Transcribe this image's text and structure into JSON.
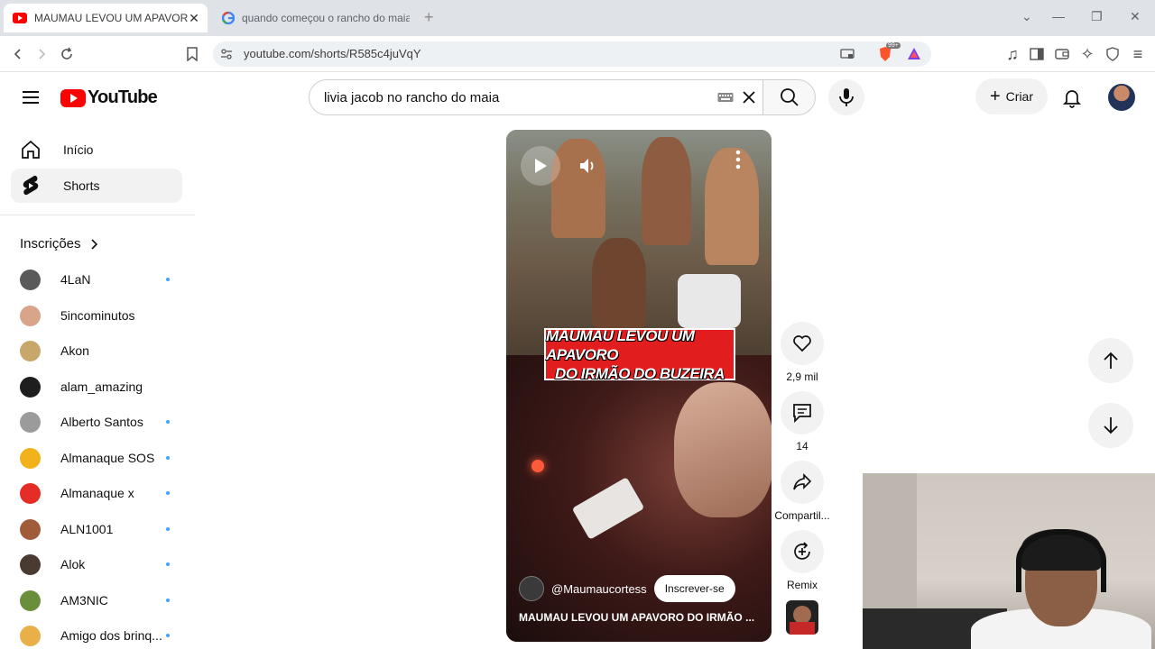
{
  "browser": {
    "tabs": [
      {
        "title": "MAUMAU LEVOU UM APAVORO",
        "active": true
      },
      {
        "title": "quando começou o rancho do maia",
        "active": false
      }
    ],
    "url": "youtube.com/shorts/R585c4juVqY",
    "extension_badge": "99+"
  },
  "header": {
    "logo_text": "YouTube",
    "search_query": "livia jacob no rancho do maia",
    "create_label": "Criar"
  },
  "sidebar": {
    "items": [
      {
        "label": "Início",
        "icon": "home-icon",
        "selected": false
      },
      {
        "label": "Shorts",
        "icon": "shorts-icon",
        "selected": true
      }
    ],
    "subscriptions_title": "Inscrições",
    "subscriptions": [
      {
        "name": "4LaN",
        "new": true,
        "color": "#5a5a5a"
      },
      {
        "name": "5incominutos",
        "new": false,
        "color": "#d9a58a"
      },
      {
        "name": "Akon",
        "new": false,
        "color": "#c7a86a"
      },
      {
        "name": "alam_amazing",
        "new": false,
        "color": "#1e1e1e"
      },
      {
        "name": "Alberto Santos",
        "new": true,
        "color": "#9b9b9b"
      },
      {
        "name": "Almanaque SOS",
        "new": true,
        "color": "#f2b21b"
      },
      {
        "name": "Almanaque x",
        "new": true,
        "color": "#e52d27"
      },
      {
        "name": "ALN1001",
        "new": true,
        "color": "#a05c3a"
      },
      {
        "name": "Alok",
        "new": true,
        "color": "#4a3b32"
      },
      {
        "name": "AM3NIC",
        "new": true,
        "color": "#6a8f3a"
      },
      {
        "name": "Amigo dos brinq...",
        "new": true,
        "color": "#e9b04a"
      }
    ]
  },
  "short": {
    "caption_line1": "MAUMAU LEVOU UM APAVORO",
    "caption_line2": "DO IRMÃO DO BUZEIRA",
    "channel": "@Maumaucortess",
    "subscribe_label": "Inscrever-se",
    "title": "MAUMAU LEVOU UM APAVORO DO IRMÃO ..."
  },
  "actions": {
    "likes": "2,9 mil",
    "comments": "14",
    "share": "Compartil...",
    "remix": "Remix"
  },
  "colors": {
    "youtube_red": "#ff0000",
    "caption_red": "#e21d1d",
    "unread_dot": "#3ea6ff"
  }
}
